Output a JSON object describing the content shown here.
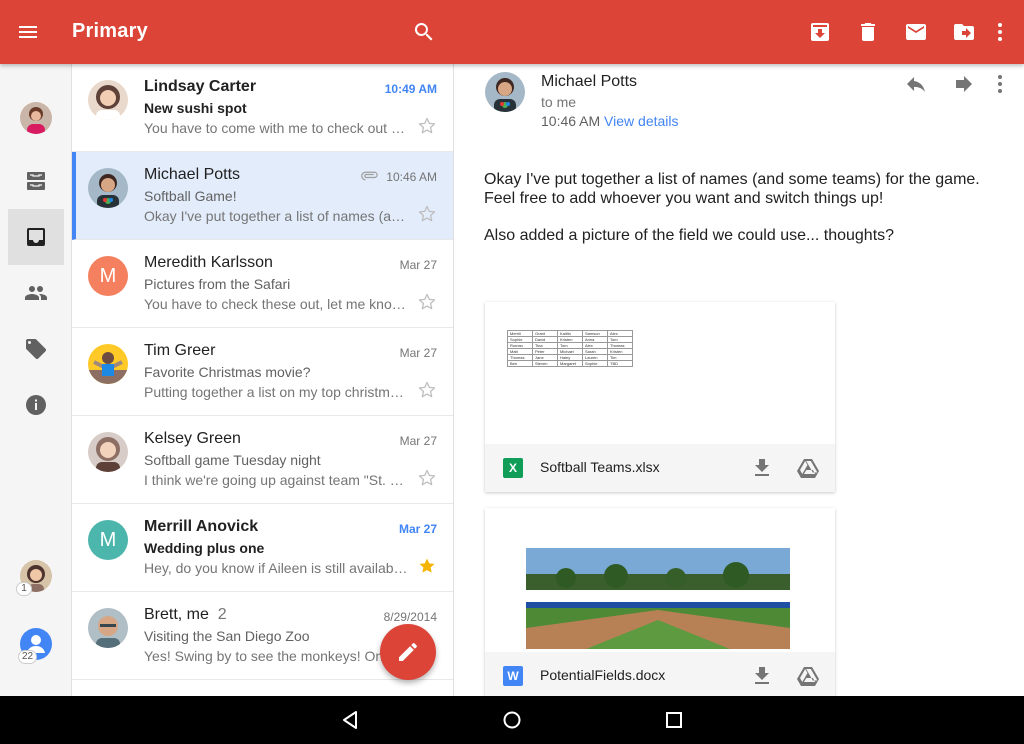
{
  "appbar": {
    "title": "Primary",
    "color": "#db4437"
  },
  "rail": {
    "badge_top": "1",
    "badge_bottom": "22"
  },
  "messages": [
    {
      "sender": "Lindsay Carter",
      "date": "10:49 AM",
      "subject": "New sushi spot",
      "snippet": "You have to come with me to check out thi...",
      "unread": true,
      "starred": false
    },
    {
      "sender": "Michael Potts",
      "date": "10:46 AM",
      "subject": "Softball Game!",
      "snippet": "Okay I've put together a list of names (and...",
      "selected": true,
      "attachment": true,
      "starred": false
    },
    {
      "sender": "Meredith Karlsson",
      "date": "Mar 27",
      "subject": "Pictures from the Safari",
      "snippet": "You have to check these out, let me know ...",
      "avatar_letter": "M",
      "avatar_color": "#f4805f",
      "starred": false
    },
    {
      "sender": "Tim Greer",
      "date": "Mar 27",
      "subject": "Favorite Christmas movie?",
      "snippet": "Putting together a list on my top christmas...",
      "starred": false
    },
    {
      "sender": "Kelsey Green",
      "date": "Mar 27",
      "subject": "Softball game Tuesday night",
      "snippet": "I think we're going up against team \"St. El...",
      "starred": false
    },
    {
      "sender": "Merrill Anovick",
      "date": "Mar 27",
      "subject": "Wedding plus one",
      "snippet": "Hey, do you know if Aileen is still available...",
      "avatar_letter": "M",
      "avatar_color": "#4db6ac",
      "unread": true,
      "starred": true
    },
    {
      "sender": "Brett, me",
      "count": "2",
      "date": "8/29/2014",
      "subject": "Visiting the San Diego Zoo",
      "snippet": "Yes! Swing by to see the monkeys! On F",
      "starred": false
    }
  ],
  "reader": {
    "from": "Michael Potts",
    "to": "to me",
    "time": "10:46 AM",
    "details_link": "View details",
    "body_p1": "Okay I've put together a list of names (and some teams) for the game. Feel free to add whoever you want and switch things up!",
    "body_p2": "Also added a picture of the field we could use... thoughts?",
    "attachments": [
      {
        "name": "Softball Teams.xlsx",
        "type_letter": "X",
        "type_color": "#0f9d58"
      },
      {
        "name": "PotentialFields.docx",
        "type_letter": "W",
        "type_color": "#4285f4"
      }
    ],
    "sheet": [
      [
        "Merrill",
        "Grant",
        "Kaitlin",
        "Samson",
        "Alex"
      ],
      [
        "Sophie",
        "David",
        "Kristen",
        "Anna",
        "Tom"
      ],
      [
        "Roman",
        "Tina",
        "Tom",
        "Alex",
        "Thomas"
      ],
      [
        "Matt",
        "Peter",
        "Michael",
        "Sarah",
        "Kristen"
      ],
      [
        "Thomas",
        "Jane",
        "Haley",
        "Lauren",
        "Tim"
      ],
      [
        "Ben",
        "Steven",
        "Margaret",
        "Sophie",
        "TBD"
      ]
    ]
  }
}
